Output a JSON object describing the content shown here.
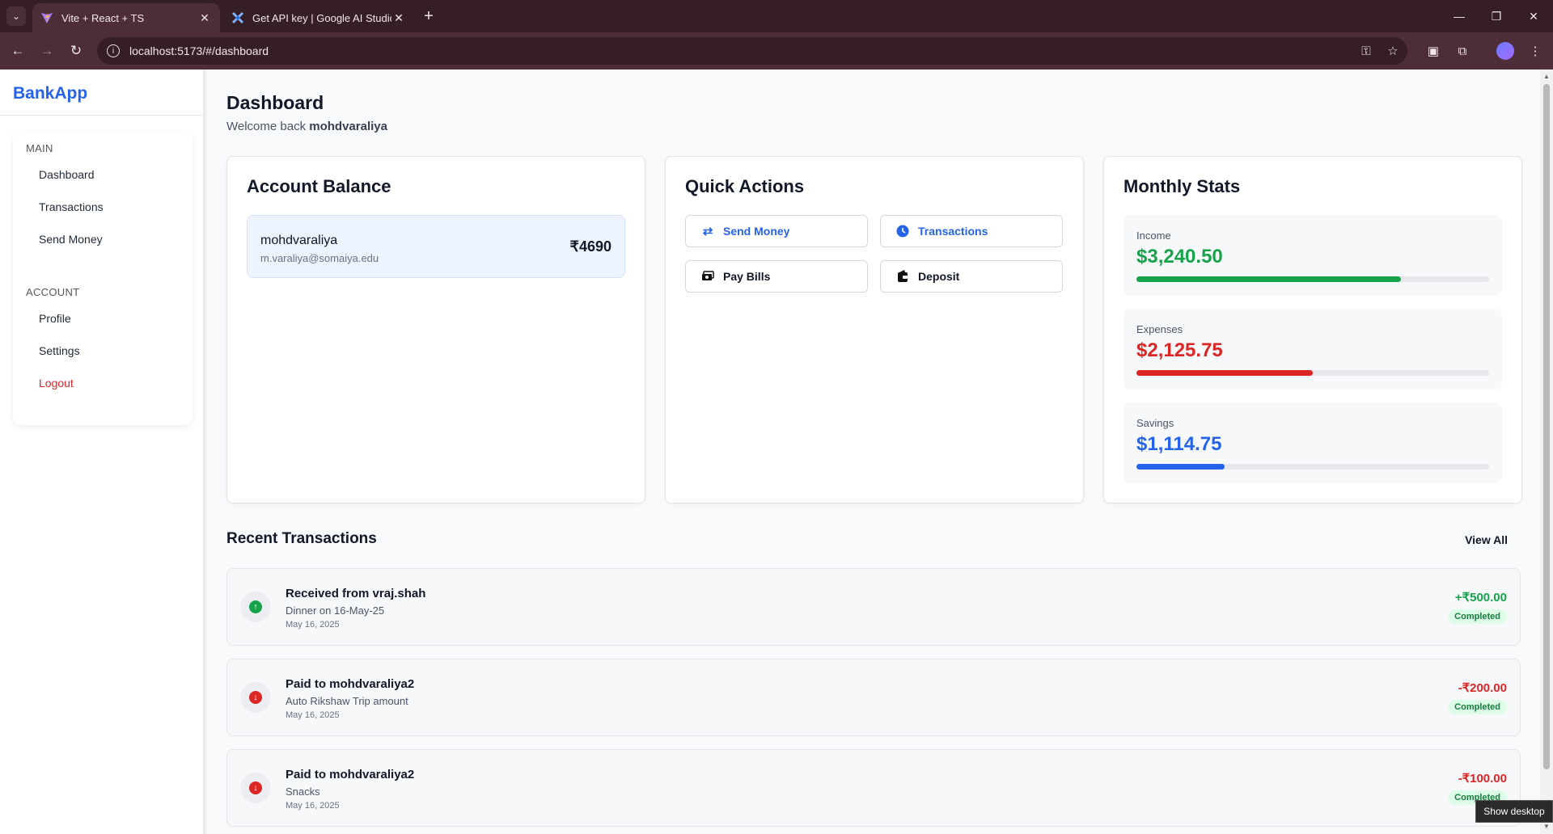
{
  "browser": {
    "tabs": [
      {
        "title": "Vite + React + TS",
        "favicon": "vite-icon",
        "active": true
      },
      {
        "title": "Get API key | Google AI Studio",
        "favicon": "ai-studio-icon",
        "active": false
      }
    ],
    "url": "localhost:5173/#/dashboard"
  },
  "sidebar": {
    "brand": "BankApp",
    "sections": [
      {
        "title": "MAIN",
        "items": [
          {
            "label": "Dashboard"
          },
          {
            "label": "Transactions"
          },
          {
            "label": "Send Money"
          }
        ]
      },
      {
        "title": "ACCOUNT",
        "items": [
          {
            "label": "Profile"
          },
          {
            "label": "Settings"
          },
          {
            "label": "Logout"
          }
        ]
      }
    ]
  },
  "header": {
    "title": "Dashboard",
    "welcome_prefix": "Welcome back",
    "username": "mohdvaraliya"
  },
  "account_balance": {
    "title": "Account Balance",
    "name": "mohdvaraliya",
    "email": "m.varaliya@somaiya.edu",
    "balance": "₹4690"
  },
  "quick_actions": {
    "title": "Quick Actions",
    "buttons": [
      {
        "label": "Send Money",
        "icon": "swap-arrows-icon"
      },
      {
        "label": "Transactions",
        "icon": "clock-icon"
      },
      {
        "label": "Pay Bills",
        "icon": "cash-icon"
      },
      {
        "label": "Deposit",
        "icon": "wallet-icon"
      }
    ]
  },
  "monthly_stats": {
    "title": "Monthly Stats",
    "stats": [
      {
        "label": "Income",
        "value": "$3,240.50",
        "color": "#16a34a",
        "fill_fraction": 0.75
      },
      {
        "label": "Expenses",
        "value": "$2,125.75",
        "color": "#dc2626",
        "fill_fraction": 0.5
      },
      {
        "label": "Savings",
        "value": "$1,114.75",
        "color": "#2563eb",
        "fill_fraction": 0.25
      }
    ]
  },
  "recent_transactions": {
    "title": "Recent Transactions",
    "view_all": "View All",
    "items": [
      {
        "title": "Received from vraj.shah",
        "description": "Dinner on 16-May-25",
        "date": "May 16, 2025",
        "amount": "+₹500.00",
        "status": "Completed",
        "direction": "in",
        "color": "#16a34a"
      },
      {
        "title": "Paid to mohdvaraliya2",
        "description": "Auto Rikshaw Trip amount",
        "date": "May 16, 2025",
        "amount": "-₹200.00",
        "status": "Completed",
        "direction": "out",
        "color": "#dc2626"
      },
      {
        "title": "Paid to mohdvaraliya2",
        "description": "Snacks",
        "date": "May 16, 2025",
        "amount": "-₹100.00",
        "status": "Completed",
        "direction": "out",
        "color": "#dc2626"
      }
    ]
  },
  "tooltip": "Show desktop"
}
